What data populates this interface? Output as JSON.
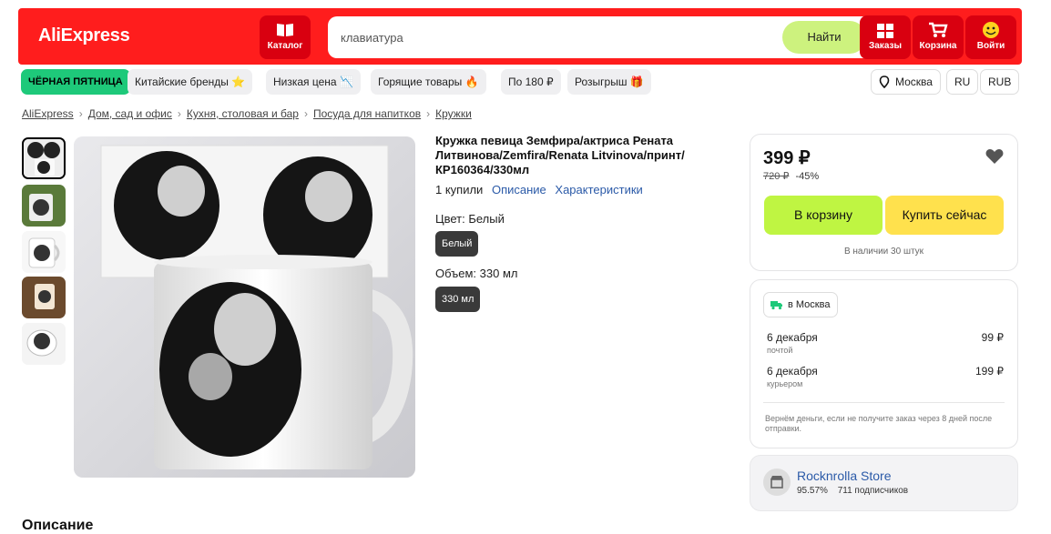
{
  "header": {
    "logo": "AliExpress",
    "catalog_label": "Каталог",
    "search_placeholder": "клавиатура",
    "find_label": "Найти",
    "orders_label": "Заказы",
    "cart_label": "Корзина",
    "login_label": "Войти"
  },
  "chips": {
    "black_friday": "ЧЁРНАЯ ПЯТНИЦА",
    "chinese_brands": "Китайские бренды ⭐",
    "low_price": "Низкая цена 📉",
    "hot_goods": "Горящие товары 🔥",
    "for_180": "По 180 ₽",
    "giveaway": "Розыгрыш 🎁",
    "city": "Москва",
    "language": "RU",
    "currency": "RUB"
  },
  "breadcrumbs": [
    "AliExpress",
    "Дом, сад и офис",
    "Кухня, столовая и бар",
    "Посуда для напитков",
    "Кружки"
  ],
  "product": {
    "title": "Кружка певица Земфира/актриса Рената Литвинова/Zemfira/Renata Litvinova/принт/КР160364/330мл",
    "sold": "1 купили",
    "description_link": "Описание",
    "specs_link": "Характеристики",
    "color_label": "Цвет: Белый",
    "color_option": "Белый",
    "volume_label": "Объем: 330 мл",
    "volume_option": "330 мл"
  },
  "buy": {
    "price": "399 ₽",
    "old_price": "720 ₽",
    "discount": "-45%",
    "add_to_cart": "В корзину",
    "buy_now": "Купить сейчас",
    "stock": "В наличии 30 штук"
  },
  "delivery": {
    "city": "в Москва",
    "options": [
      {
        "date": "6 декабря",
        "method": "почтой",
        "price": "99 ₽"
      },
      {
        "date": "6 декабря",
        "method": "курьером",
        "price": "199 ₽"
      }
    ],
    "refund_note": "Вернём деньги, если не получите заказ через 8 дней после отправки."
  },
  "store": {
    "name": "Rocknrolla Store",
    "rating": "95.57%",
    "subscribers": "711 подписчиков"
  },
  "section_title": "Описание",
  "colors": {
    "header_bg": "#ff1d1d",
    "header_button_bg": "#d90010",
    "find_button": "#cdf27e",
    "black_friday": "#1ec97a",
    "cart_button": "#bff542",
    "buy_button": "#ffe14d",
    "link": "#2b5aa8"
  },
  "icons": [
    "catalog-icon",
    "orders-icon",
    "cart-icon",
    "login-icon",
    "location-pin-icon",
    "heart-icon",
    "truck-icon",
    "store-icon"
  ]
}
